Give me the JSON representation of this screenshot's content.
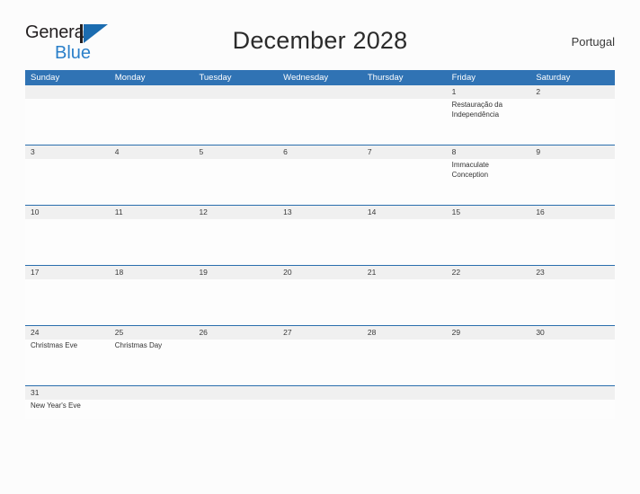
{
  "brand": {
    "name_line1": "General",
    "name_line2": "Blue",
    "accent_color": "#2a7fc9",
    "mark_color": "#1b6cb0"
  },
  "header": {
    "title": "December 2028",
    "region": "Portugal"
  },
  "theme": {
    "header_blue": "#3073b4",
    "row_divider_blue": "#2a6ead",
    "date_band_gray": "#f0f0f0",
    "page_background": "#fcfcfc",
    "text_color": "#333333"
  },
  "calendar": {
    "weekdays": [
      "Sunday",
      "Monday",
      "Tuesday",
      "Wednesday",
      "Thursday",
      "Friday",
      "Saturday"
    ],
    "weeks": [
      {
        "days": [
          {
            "number": "",
            "event": ""
          },
          {
            "number": "",
            "event": ""
          },
          {
            "number": "",
            "event": ""
          },
          {
            "number": "",
            "event": ""
          },
          {
            "number": "",
            "event": ""
          },
          {
            "number": "1",
            "event": "Restauração da Independência"
          },
          {
            "number": "2",
            "event": ""
          }
        ]
      },
      {
        "days": [
          {
            "number": "3",
            "event": ""
          },
          {
            "number": "4",
            "event": ""
          },
          {
            "number": "5",
            "event": ""
          },
          {
            "number": "6",
            "event": ""
          },
          {
            "number": "7",
            "event": ""
          },
          {
            "number": "8",
            "event": "Immaculate Conception"
          },
          {
            "number": "9",
            "event": ""
          }
        ]
      },
      {
        "days": [
          {
            "number": "10",
            "event": ""
          },
          {
            "number": "11",
            "event": ""
          },
          {
            "number": "12",
            "event": ""
          },
          {
            "number": "13",
            "event": ""
          },
          {
            "number": "14",
            "event": ""
          },
          {
            "number": "15",
            "event": ""
          },
          {
            "number": "16",
            "event": ""
          }
        ]
      },
      {
        "days": [
          {
            "number": "17",
            "event": ""
          },
          {
            "number": "18",
            "event": ""
          },
          {
            "number": "19",
            "event": ""
          },
          {
            "number": "20",
            "event": ""
          },
          {
            "number": "21",
            "event": ""
          },
          {
            "number": "22",
            "event": ""
          },
          {
            "number": "23",
            "event": ""
          }
        ]
      },
      {
        "days": [
          {
            "number": "24",
            "event": "Christmas Eve"
          },
          {
            "number": "25",
            "event": "Christmas Day"
          },
          {
            "number": "26",
            "event": ""
          },
          {
            "number": "27",
            "event": ""
          },
          {
            "number": "28",
            "event": ""
          },
          {
            "number": "29",
            "event": ""
          },
          {
            "number": "30",
            "event": ""
          }
        ]
      },
      {
        "days": [
          {
            "number": "31",
            "event": "New Year's Eve"
          },
          {
            "number": "",
            "event": ""
          },
          {
            "number": "",
            "event": ""
          },
          {
            "number": "",
            "event": ""
          },
          {
            "number": "",
            "event": ""
          },
          {
            "number": "",
            "event": ""
          },
          {
            "number": "",
            "event": ""
          }
        ]
      }
    ]
  }
}
